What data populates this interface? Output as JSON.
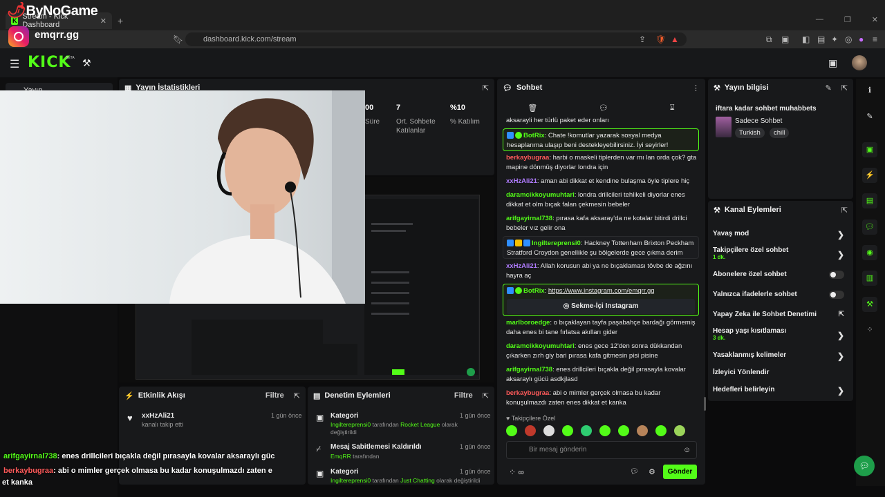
{
  "watermark": {
    "brand": "ByNoGame",
    "instagram_handle": "emqrr.gg"
  },
  "browser": {
    "tab_title": "Stream - Kick Dashboard",
    "url": "dashboard.kick.com/stream"
  },
  "kick": {
    "logo": "KICK",
    "beta": "BETA"
  },
  "sidebar": {
    "item": "Yayın"
  },
  "stats": {
    "title": "Yayın İstatistikleri",
    "items": [
      {
        "value": "00",
        "label": "Süre"
      },
      {
        "value": "7",
        "label": "Ort. Sohbete Katılanlar"
      },
      {
        "value": "%10",
        "label": "% Katılım"
      }
    ]
  },
  "feed": {
    "title": "Etkinlik Akışı",
    "filter": "Filtre",
    "items": [
      {
        "user": "xxHzAli21",
        "text": "kanalı takip etti",
        "time": "1 gün önce"
      }
    ]
  },
  "moderation": {
    "title": "Denetim Eylemleri",
    "filter": "Filtre",
    "items": [
      {
        "title": "Kategori",
        "actor": "Ingiltereprensi0",
        "mid": "tarafından",
        "target": "Rocket League",
        "suffix": "olarak değiştirildi",
        "time": "1 gün önce"
      },
      {
        "title": "Mesaj Sabitlemesi Kaldırıldı",
        "actor": "EmqRR",
        "mid": "tarafından",
        "time": "1 gün önce"
      },
      {
        "title": "Kategori",
        "actor": "Ingiltereprensi0",
        "mid": "tarafından",
        "target": "Just Chatting",
        "suffix": "olarak değiştirildi",
        "time": "1 gün önce"
      }
    ]
  },
  "chat": {
    "title": "Sohbet",
    "messages": [
      {
        "text": "aksarayli her türlü paket eder onları"
      },
      {
        "user": "BotRix",
        "text": "Chate !komutlar yazarak sosyal medya hesaplarıma ulaşıp beni destekleyebilirsiniz. İyi seyirler!",
        "bot": true
      },
      {
        "user": "berkaybugraa",
        "text": "harbi o maskeli tiplerden var mı lan orda çok? gta mapine dönmüş diyorlar londra için",
        "color": "#ff5a5a"
      },
      {
        "user": "xxHzAli21",
        "text": "aman abi dikkat et kendine bulaşma öyle tiplere hiç",
        "color": "#b07cff"
      },
      {
        "user": "daramcikkoyumuhtari",
        "text": "londra drillcileri tehlikeli diyorlar enes dikkat et olm bıçak falan çekmesin bebeler",
        "color": "#53fc18"
      },
      {
        "user": "arifgayirnal738",
        "text": "pırasa kafa aksaray'da ne kotalar bitirdi drillci bebeler vız gelir ona",
        "color": "#53fc18"
      },
      {
        "user": "Ingiltereprensi0",
        "text": "Hackney Tottenham Brixton Peckham Stratford Croydon genellikle şu bölgelerde gece çıkma derim",
        "highlight": true
      },
      {
        "user": "xxHzAli21",
        "text": "Allah korusun abi ya ne bıçaklaması tövbe de ağzını hayra aç",
        "color": "#b07cff"
      },
      {
        "user": "BotRix",
        "text": "https://www.instagram.com/emqrr.gg",
        "bot": true,
        "button": "Sekme-İçi Instagram"
      },
      {
        "user": "marlboroedge",
        "text": "o bıçaklayan tayfa paşabahçe bardağı görmemiş daha enes bi tane fırlatsa akılları gider",
        "color": "#53fc18"
      },
      {
        "user": "daramcikkoyumuhtari",
        "text": "enes gece 12'den sonra dükkandan çıkarken zırh giy bari pırasa kafa gitmesin pisi pisine",
        "color": "#53fc18"
      },
      {
        "user": "arifgayirnal738",
        "text": "enes drillcileri bıçakla değil pırasayla kovalar aksaraylı gücü asdkjlasd",
        "color": "#53fc18"
      },
      {
        "user": "berkaybugraa",
        "text": "abi o mimler gerçek olmasa bu kadar konuşulmazdı zaten enes dikkat et kanka",
        "color": "#ff5a5a"
      }
    ],
    "follower_label": "Takipçilere Özel",
    "input_placeholder": "Bir mesaj gönderin",
    "send": "Gönder"
  },
  "stream_info": {
    "title": "Yayın bilgisi",
    "stream_title": "iftara kadar sohbet muhabbets",
    "category": "Sadece Sohbet",
    "tags": [
      "Turkish",
      "chill"
    ]
  },
  "channel_actions": {
    "title": "Kanal Eylemleri",
    "items": [
      {
        "label": "Yavaş mod",
        "control": "chevron"
      },
      {
        "label": "Takipçilere özel sohbet",
        "sub": "1 dk.",
        "control": "chevron"
      },
      {
        "label": "Abonelere özel sohbet",
        "control": "toggle"
      },
      {
        "label": "Yalnızca ifadelerle sohbet",
        "control": "toggle"
      },
      {
        "label": "Yapay Zeka ile Sohbet Denetimi",
        "control": "external"
      },
      {
        "label": "Hesap yaşı kısıtlaması",
        "sub": "3 dk.",
        "control": "chevron"
      },
      {
        "label": "Yasaklanmış kelimeler",
        "control": "chevron"
      },
      {
        "label": "İzleyici Yönlendir",
        "control": "none"
      },
      {
        "label": "Hedefleri belirleyin",
        "control": "chevron"
      }
    ]
  },
  "overlay_chat": [
    {
      "user": "arifgayirnal738",
      "text": ": enes drillcileri bıçakla değil pırasayla kovalar aksaraylı güc",
      "color": "#53fc18"
    },
    {
      "user": "berkaybugraa",
      "text": ": abi o mimler gerçek olmasa bu kadar konuşulmazdı zaten e",
      "color": "#ff5a5a"
    },
    {
      "text": "et kanka"
    }
  ]
}
